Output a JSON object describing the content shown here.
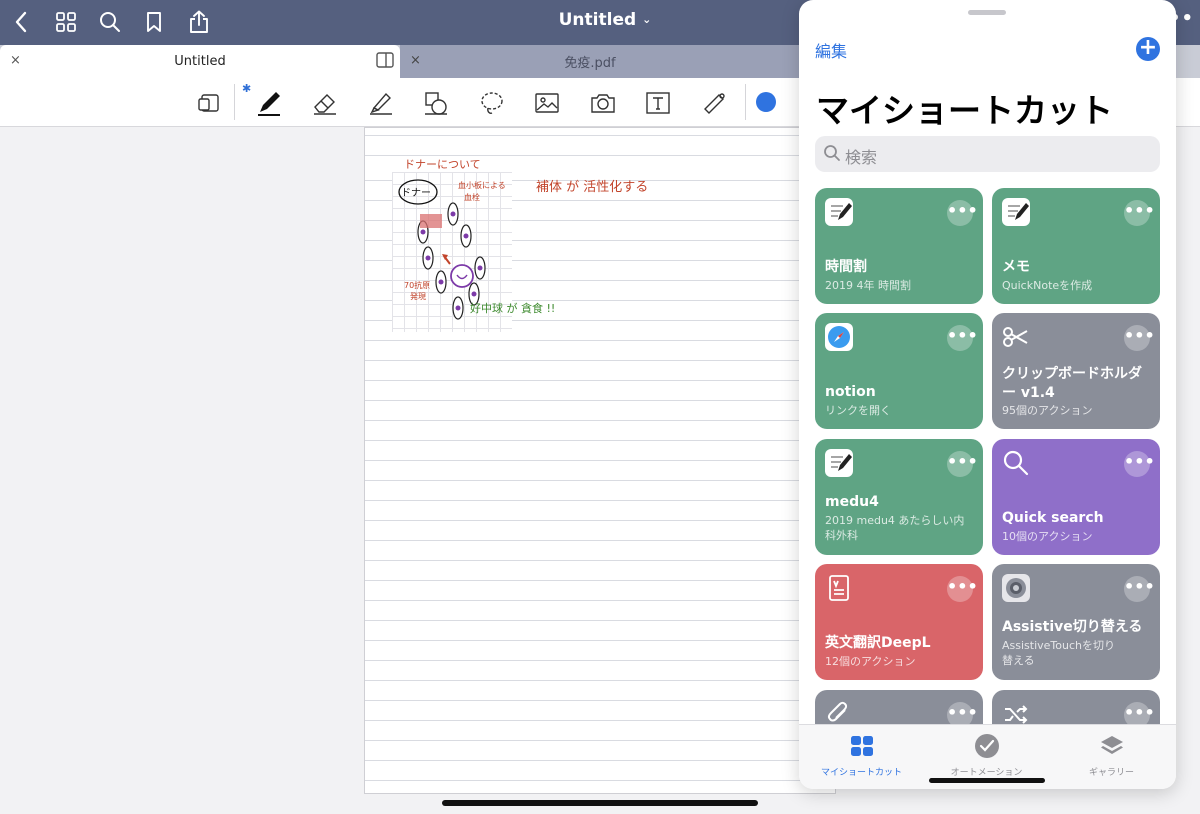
{
  "topbar": {
    "title": "Untitled",
    "title_chevron": "⌄",
    "more": "•••",
    "icons": [
      "back-icon",
      "thumbnails-icon",
      "search-icon",
      "bookmark-icon",
      "share-icon"
    ]
  },
  "tabs": [
    {
      "label": "Untitled",
      "close": "×",
      "active": true
    },
    {
      "label": "免疫.pdf",
      "close": "×",
      "active": false
    }
  ],
  "toolbar": {
    "bluetooth": "✱",
    "tools": [
      "page-tool-icon",
      "pen-icon",
      "eraser-icon",
      "highlighter-icon",
      "shapes-icon",
      "lasso-icon",
      "image-icon",
      "camera-icon",
      "text-icon",
      "laser-pointer-icon"
    ],
    "current_color": "#2f73e0"
  },
  "note": {
    "heading": "ドナーについて",
    "line1": "補体 が 活性化する",
    "line2": "好中球 が 貪食 !!",
    "label_donor": "ドナー",
    "label_a": "血小板による",
    "label_b": "血栓",
    "label_c": "70抗原",
    "label_d": "発現"
  },
  "shortcuts": {
    "edit": "編集",
    "add": "+",
    "title": "マイショートカット",
    "search_placeholder": "検索",
    "more": "•••",
    "cards": [
      {
        "name": "時間割",
        "sub": "2019 4年 時間割",
        "color": "green",
        "icon": "note-icon"
      },
      {
        "name": "メモ",
        "sub": "QuickNoteを作成",
        "color": "green",
        "icon": "note-icon"
      },
      {
        "name": "notion",
        "sub": "リンクを開く",
        "color": "green",
        "icon": "safari-icon"
      },
      {
        "name": "クリップボードホルダー v1.4",
        "sub": "95個のアクション",
        "color": "gray",
        "icon": "scissors-icon"
      },
      {
        "name": "medu4",
        "sub": "2019 medu4 あたらしい内科外科",
        "color": "green",
        "icon": "note-icon"
      },
      {
        "name": "Quick search",
        "sub": "10個のアクション",
        "color": "purple",
        "icon": "search-icon"
      },
      {
        "name": "英文翻訳DeepL",
        "sub": "12個のアクション",
        "color": "red",
        "icon": "document-icon"
      },
      {
        "name": "Assistive切り替える",
        "sub": "AssistiveTouchを切り替える",
        "color": "gray",
        "icon": "settings-icon"
      },
      {
        "name": "",
        "sub": "",
        "color": "gray",
        "icon": "paperclip-icon"
      },
      {
        "name": "",
        "sub": "",
        "color": "gray",
        "icon": "shuffle-icon"
      }
    ],
    "tabbar": [
      {
        "label": "マイショートカット",
        "active": true
      },
      {
        "label": "オートメーション",
        "active": false
      },
      {
        "label": "ギャラリー",
        "active": false
      }
    ]
  }
}
